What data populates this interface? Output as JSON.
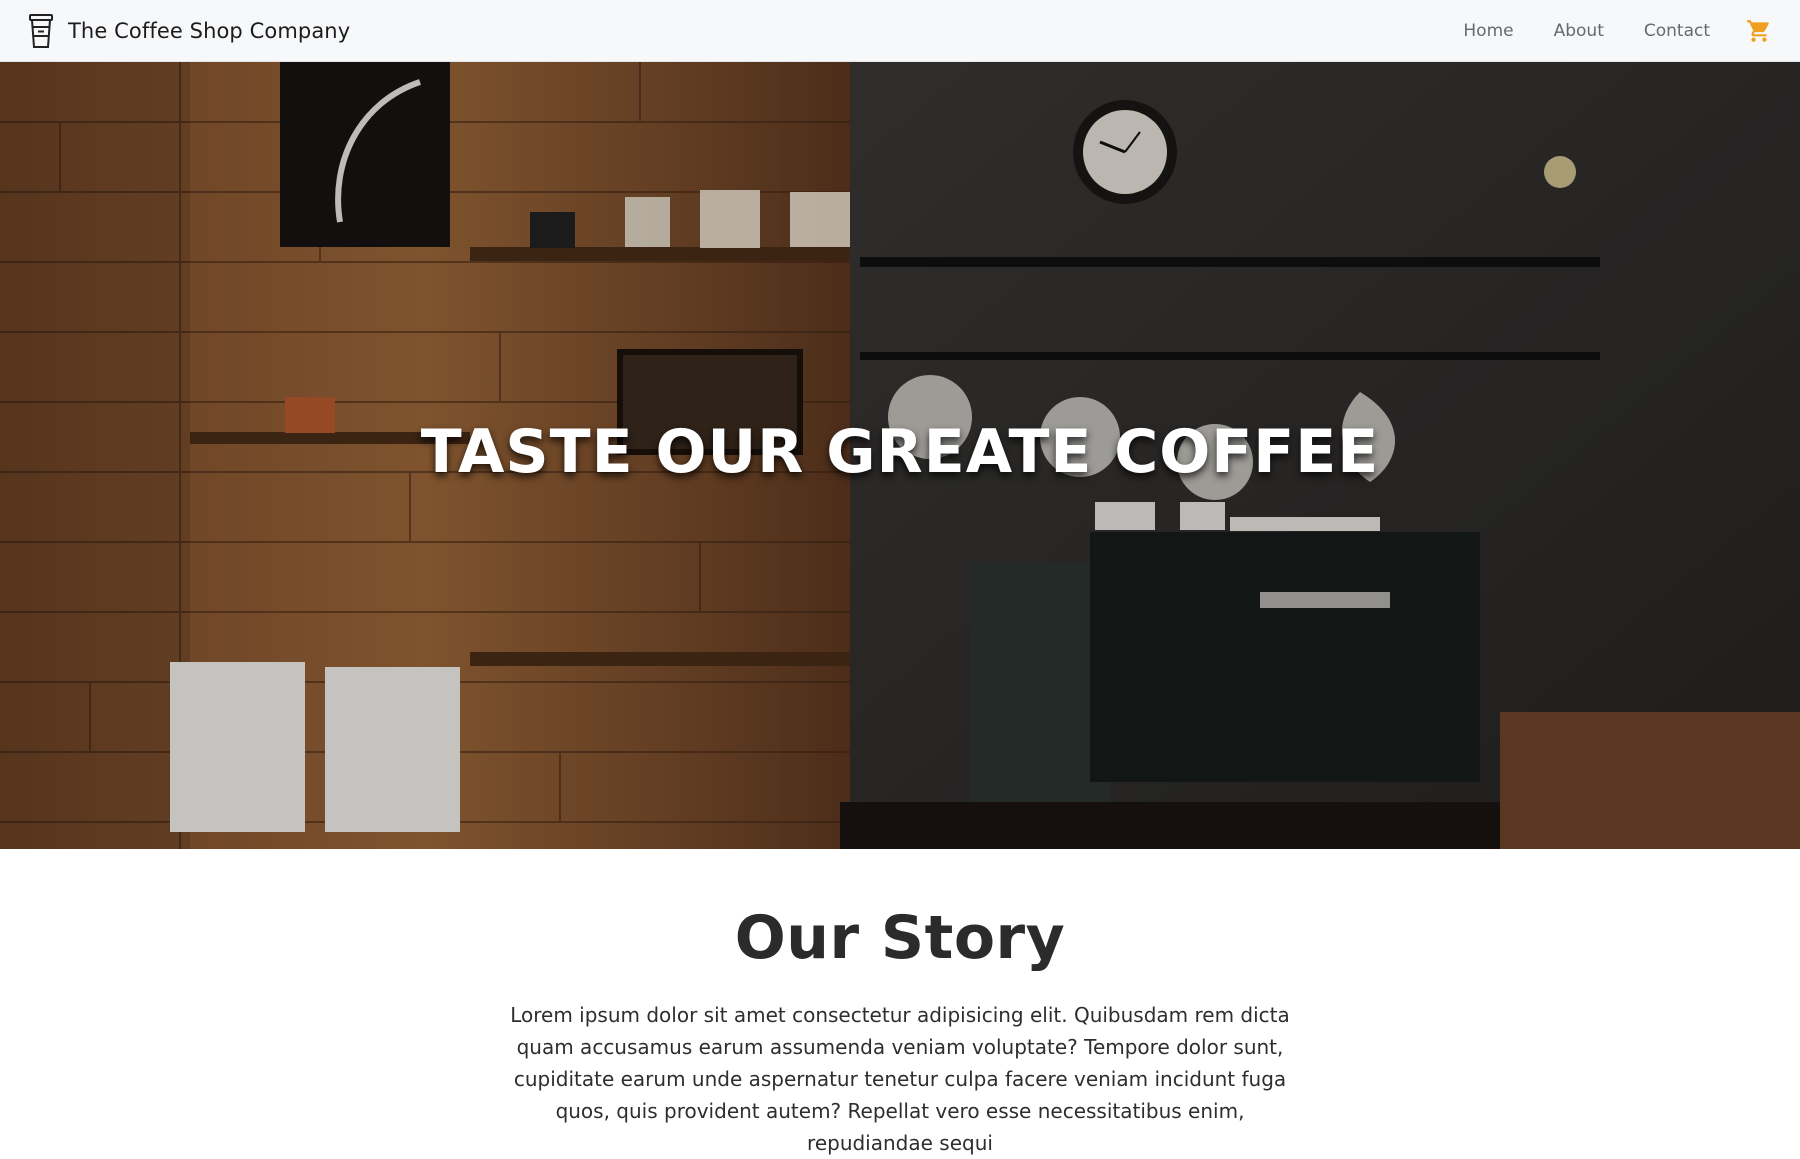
{
  "navbar": {
    "brand_name": "The Coffee Shop Company",
    "brand_icon": "coffee-cup-icon",
    "links": [
      {
        "label": "Home"
      },
      {
        "label": "About"
      },
      {
        "label": "Contact"
      }
    ],
    "cart_icon": "shopping-cart-icon",
    "cart_color": "#f0a020"
  },
  "hero": {
    "title": "TASTE OUR GREATE COFFEE",
    "image_description": "coffee shop interior"
  },
  "story": {
    "heading": "Our Story",
    "text": "Lorem ipsum dolor sit amet consectetur adipisicing elit. Quibusdam rem dicta quam accusamus earum assumenda veniam voluptate? Tempore dolor sunt, cupiditate earum unde aspernatur tenetur culpa facere veniam incidunt fuga quos, quis provident autem? Repellat vero esse necessitatibus enim, repudiandae sequi"
  }
}
